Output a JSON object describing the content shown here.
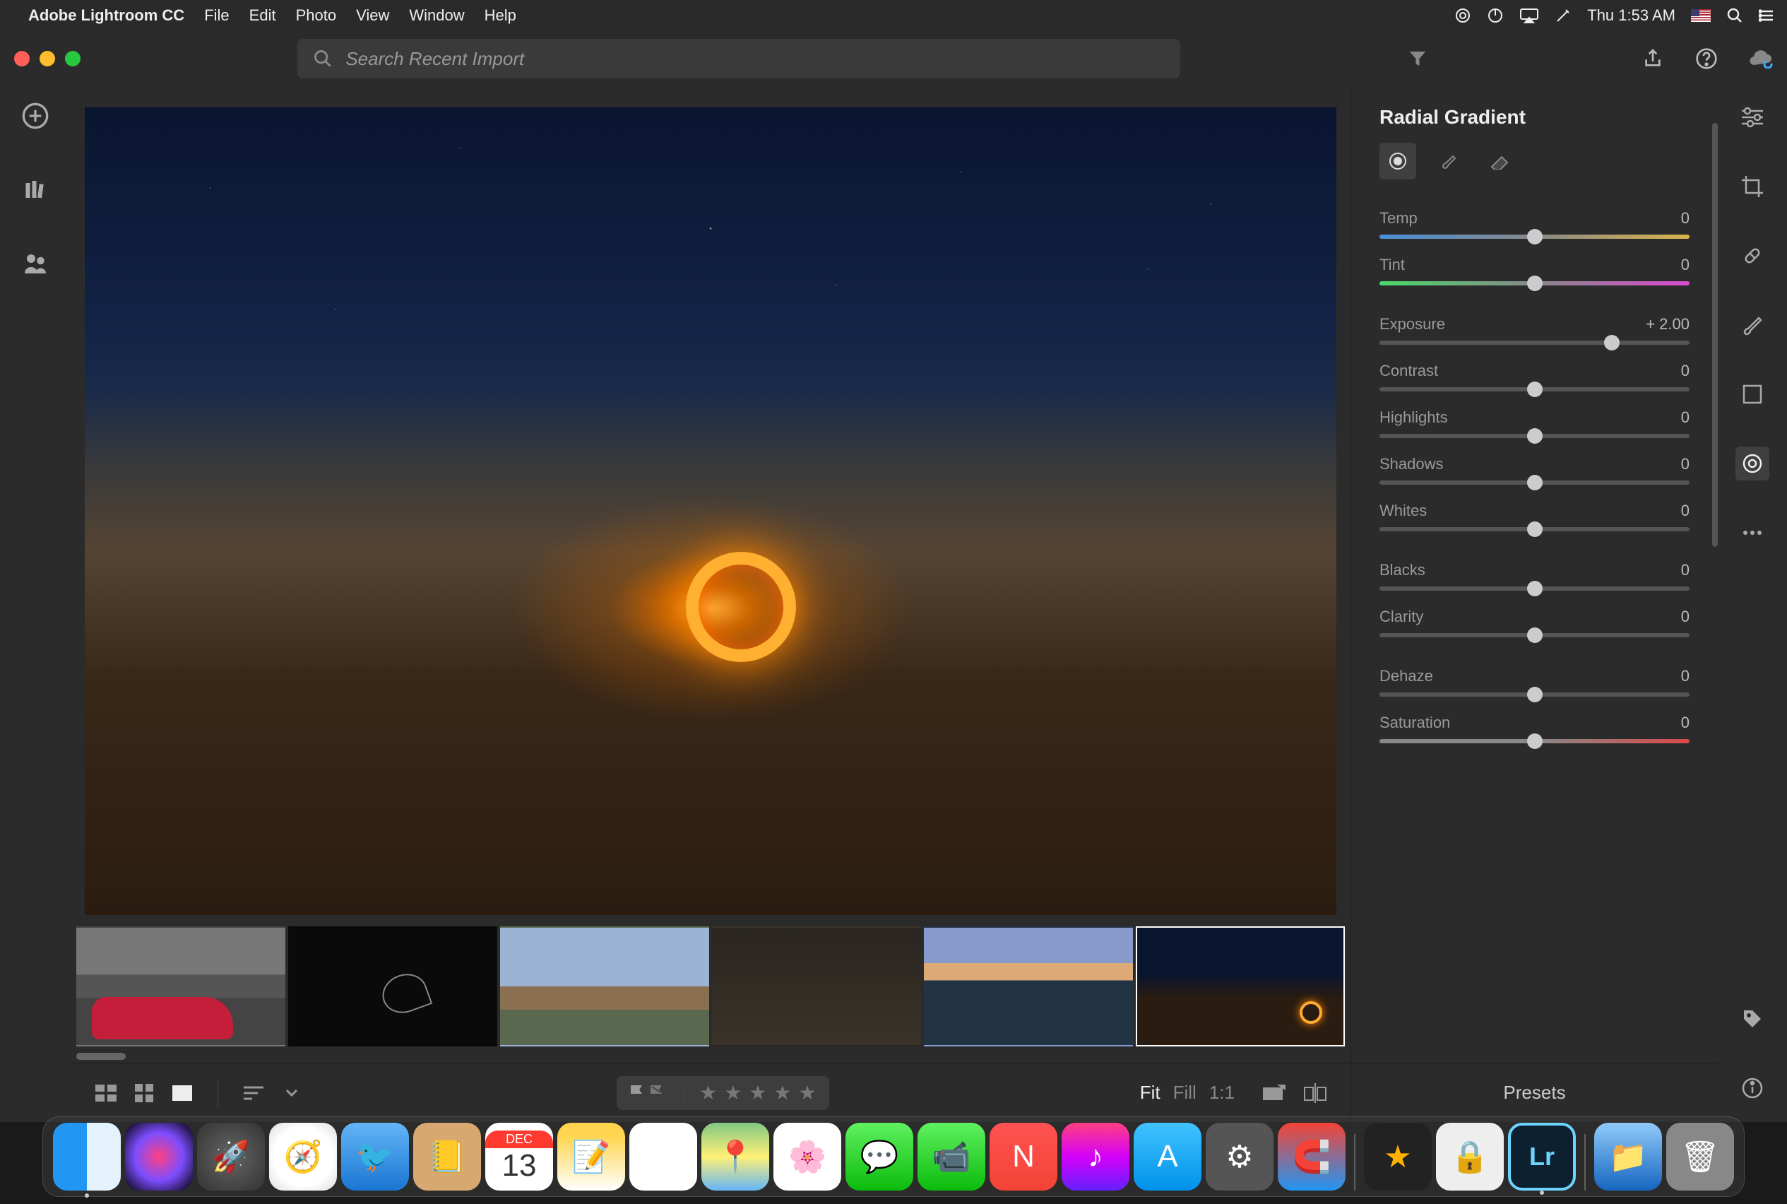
{
  "menubar": {
    "app_name": "Adobe Lightroom CC",
    "items": [
      "File",
      "Edit",
      "Photo",
      "View",
      "Window",
      "Help"
    ],
    "clock": "Thu 1:53 AM"
  },
  "search": {
    "placeholder": "Search Recent Import"
  },
  "panel": {
    "title": "Radial Gradient",
    "sliders": [
      {
        "label": "Temp",
        "value_text": "0",
        "pos": 50,
        "track": "temp"
      },
      {
        "label": "Tint",
        "value_text": "0",
        "pos": 50,
        "track": "tint"
      },
      {
        "label": "Exposure",
        "value_text": "+ 2.00",
        "pos": 75,
        "track": "plain"
      },
      {
        "label": "Contrast",
        "value_text": "0",
        "pos": 50,
        "track": "plain"
      },
      {
        "label": "Highlights",
        "value_text": "0",
        "pos": 50,
        "track": "plain"
      },
      {
        "label": "Shadows",
        "value_text": "0",
        "pos": 50,
        "track": "plain"
      },
      {
        "label": "Whites",
        "value_text": "0",
        "pos": 50,
        "track": "plain"
      },
      {
        "label": "Blacks",
        "value_text": "0",
        "pos": 50,
        "track": "plain"
      },
      {
        "label": "Clarity",
        "value_text": "0",
        "pos": 50,
        "track": "plain"
      },
      {
        "label": "Dehaze",
        "value_text": "0",
        "pos": 50,
        "track": "plain"
      },
      {
        "label": "Saturation",
        "value_text": "0",
        "pos": 50,
        "track": "sat"
      }
    ],
    "presets_label": "Presets"
  },
  "zoom": {
    "fit": "Fit",
    "fill": "Fill",
    "oneone": "1:1"
  },
  "calendar": {
    "month": "DEC",
    "day": "13"
  },
  "lr_label": "Lr"
}
